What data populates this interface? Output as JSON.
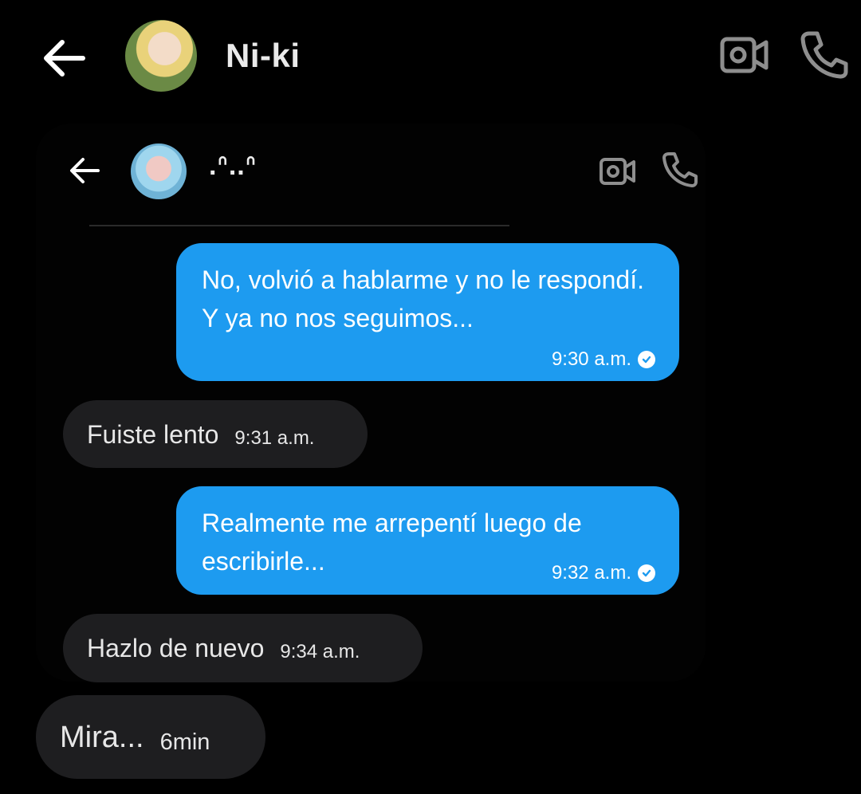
{
  "header": {
    "contact_name": "Ni-ki",
    "back_icon": "arrow-left-icon",
    "video_icon": "video-camera-icon",
    "phone_icon": "phone-icon"
  },
  "embedded_chat": {
    "contact_name": ".ᐢ..ᐢ",
    "back_icon": "arrow-left-icon",
    "video_icon": "video-camera-icon",
    "phone_icon": "phone-icon"
  },
  "colors": {
    "background": "#000000",
    "outgoing_bubble": "#1d9bf0",
    "incoming_bubble": "#1e1e20"
  },
  "messages": [
    {
      "direction": "outgoing",
      "text": "No, volvió a hablarme y no le respondí. Y ya no nos seguimos...",
      "time": "9:30 a.m.",
      "status": "read"
    },
    {
      "direction": "incoming",
      "text": "Fuiste lento",
      "time": "9:31 a.m."
    },
    {
      "direction": "outgoing",
      "text": "Realmente me arrepentí luego de escribirle...",
      "time": "9:32 a.m.",
      "status": "read"
    },
    {
      "direction": "incoming",
      "text": "Hazlo de nuevo",
      "time": "9:34 a.m."
    },
    {
      "direction": "incoming",
      "text": "Mira...",
      "time": "6min"
    }
  ]
}
